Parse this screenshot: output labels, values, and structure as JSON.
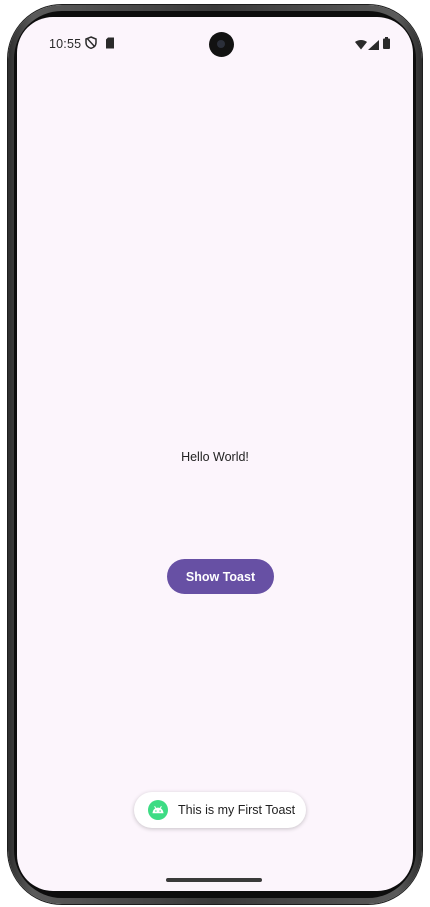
{
  "status_bar": {
    "time": "10:55",
    "left_icons": [
      "shield-icon",
      "sim-card-icon"
    ],
    "right_icons": [
      "wifi-icon",
      "signal-icon",
      "battery-icon"
    ]
  },
  "main": {
    "greeting": "Hello World!",
    "show_toast_label": "Show Toast"
  },
  "toast": {
    "message": "This is my First Toast",
    "icon": "android-icon"
  },
  "colors": {
    "background": "#fcf5fc",
    "button": "#6750a4",
    "button_text": "#ffffff",
    "android_green": "#3ddc84"
  }
}
